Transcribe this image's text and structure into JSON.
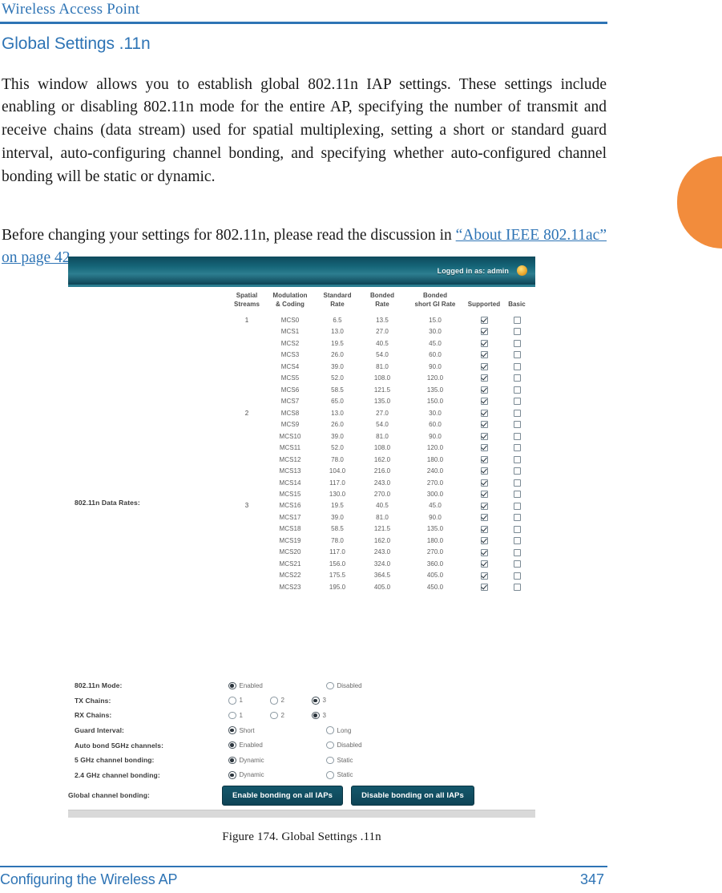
{
  "page": {
    "running_header": "Wireless Access Point",
    "section_heading": "Global Settings .11n",
    "footer_title": "Configuring the Wireless AP",
    "footer_page_number": "347",
    "accent_color": "#2e74b5",
    "tab_color": "#f28c3c"
  },
  "body": {
    "paragraph_1": "This window allows you to establish global 802.11n IAP settings. These settings include enabling or disabling 802.11n mode for the entire AP, specifying the number of transmit and receive chains (data stream) used for spatial multiplexing, setting a short or standard guard interval, auto-configuring channel bonding, and specifying whether auto-configured channel bonding will be static or dynamic.",
    "paragraph_2_lead": "Before changing your settings for 802.11n, please read the discussion in ",
    "paragraph_2_link": "“About IEEE 802.11ac” on page 42",
    "paragraph_2_tail": "."
  },
  "figure": {
    "caption": "Figure 174. Global Settings  .11n"
  },
  "screenshot": {
    "titlebar": {
      "logged_in_text": "Logged in as: admin",
      "logout_icon": "power-icon"
    },
    "rates_label": "802.11n Data Rates:",
    "table": {
      "headers": [
        "Spatial\nStreams",
        "Modulation\n& Coding",
        "Standard\nRate",
        "Bonded\nRate",
        "Bonded\nshort GI Rate",
        "Supported",
        "Basic"
      ],
      "headers_flat": {
        "spatial_streams": "Spatial Streams",
        "modulation_coding": "Modulation & Coding",
        "standard_rate": "Standard Rate",
        "bonded_rate": "Bonded Rate",
        "bonded_short_gi_rate": "Bonded short GI Rate",
        "supported": "Supported",
        "basic": "Basic"
      },
      "rows": [
        {
          "ss": "1",
          "mcs": "MCS0",
          "std": "6.5",
          "bonded": "13.5",
          "gi": "15.0",
          "supported": true,
          "basic": false
        },
        {
          "ss": "",
          "mcs": "MCS1",
          "std": "13.0",
          "bonded": "27.0",
          "gi": "30.0",
          "supported": true,
          "basic": false
        },
        {
          "ss": "",
          "mcs": "MCS2",
          "std": "19.5",
          "bonded": "40.5",
          "gi": "45.0",
          "supported": true,
          "basic": false
        },
        {
          "ss": "",
          "mcs": "MCS3",
          "std": "26.0",
          "bonded": "54.0",
          "gi": "60.0",
          "supported": true,
          "basic": false
        },
        {
          "ss": "",
          "mcs": "MCS4",
          "std": "39.0",
          "bonded": "81.0",
          "gi": "90.0",
          "supported": true,
          "basic": false
        },
        {
          "ss": "",
          "mcs": "MCS5",
          "std": "52.0",
          "bonded": "108.0",
          "gi": "120.0",
          "supported": true,
          "basic": false
        },
        {
          "ss": "",
          "mcs": "MCS6",
          "std": "58.5",
          "bonded": "121.5",
          "gi": "135.0",
          "supported": true,
          "basic": false
        },
        {
          "ss": "",
          "mcs": "MCS7",
          "std": "65.0",
          "bonded": "135.0",
          "gi": "150.0",
          "supported": true,
          "basic": false
        },
        {
          "ss": "2",
          "mcs": "MCS8",
          "std": "13.0",
          "bonded": "27.0",
          "gi": "30.0",
          "supported": true,
          "basic": false
        },
        {
          "ss": "",
          "mcs": "MCS9",
          "std": "26.0",
          "bonded": "54.0",
          "gi": "60.0",
          "supported": true,
          "basic": false
        },
        {
          "ss": "",
          "mcs": "MCS10",
          "std": "39.0",
          "bonded": "81.0",
          "gi": "90.0",
          "supported": true,
          "basic": false
        },
        {
          "ss": "",
          "mcs": "MCS11",
          "std": "52.0",
          "bonded": "108.0",
          "gi": "120.0",
          "supported": true,
          "basic": false
        },
        {
          "ss": "",
          "mcs": "MCS12",
          "std": "78.0",
          "bonded": "162.0",
          "gi": "180.0",
          "supported": true,
          "basic": false
        },
        {
          "ss": "",
          "mcs": "MCS13",
          "std": "104.0",
          "bonded": "216.0",
          "gi": "240.0",
          "supported": true,
          "basic": false
        },
        {
          "ss": "",
          "mcs": "MCS14",
          "std": "117.0",
          "bonded": "243.0",
          "gi": "270.0",
          "supported": true,
          "basic": false
        },
        {
          "ss": "",
          "mcs": "MCS15",
          "std": "130.0",
          "bonded": "270.0",
          "gi": "300.0",
          "supported": true,
          "basic": false
        },
        {
          "ss": "3",
          "mcs": "MCS16",
          "std": "19.5",
          "bonded": "40.5",
          "gi": "45.0",
          "supported": true,
          "basic": false
        },
        {
          "ss": "",
          "mcs": "MCS17",
          "std": "39.0",
          "bonded": "81.0",
          "gi": "90.0",
          "supported": true,
          "basic": false
        },
        {
          "ss": "",
          "mcs": "MCS18",
          "std": "58.5",
          "bonded": "121.5",
          "gi": "135.0",
          "supported": true,
          "basic": false
        },
        {
          "ss": "",
          "mcs": "MCS19",
          "std": "78.0",
          "bonded": "162.0",
          "gi": "180.0",
          "supported": true,
          "basic": false
        },
        {
          "ss": "",
          "mcs": "MCS20",
          "std": "117.0",
          "bonded": "243.0",
          "gi": "270.0",
          "supported": true,
          "basic": false
        },
        {
          "ss": "",
          "mcs": "MCS21",
          "std": "156.0",
          "bonded": "324.0",
          "gi": "360.0",
          "supported": true,
          "basic": false
        },
        {
          "ss": "",
          "mcs": "MCS22",
          "std": "175.5",
          "bonded": "364.5",
          "gi": "405.0",
          "supported": true,
          "basic": false
        },
        {
          "ss": "",
          "mcs": "MCS23",
          "std": "195.0",
          "bonded": "405.0",
          "gi": "450.0",
          "supported": true,
          "basic": false
        }
      ]
    },
    "settings": [
      {
        "label": "802.11n Mode:",
        "options": [
          {
            "text": "Enabled",
            "selected": true,
            "width": "w1"
          },
          {
            "text": "Disabled",
            "selected": false,
            "width": "w1"
          }
        ]
      },
      {
        "label": "TX Chains:",
        "options": [
          {
            "text": "1",
            "selected": false,
            "width": "wn"
          },
          {
            "text": "2",
            "selected": false,
            "width": "wn"
          },
          {
            "text": "3",
            "selected": true,
            "width": "wn"
          }
        ]
      },
      {
        "label": "RX Chains:",
        "options": [
          {
            "text": "1",
            "selected": false,
            "width": "wn"
          },
          {
            "text": "2",
            "selected": false,
            "width": "wn"
          },
          {
            "text": "3",
            "selected": true,
            "width": "wn"
          }
        ]
      },
      {
        "label": "Guard Interval:",
        "options": [
          {
            "text": "Short",
            "selected": true,
            "width": "w1"
          },
          {
            "text": "Long",
            "selected": false,
            "width": "w1"
          }
        ]
      },
      {
        "label": "Auto bond 5GHz channels:",
        "options": [
          {
            "text": "Enabled",
            "selected": true,
            "width": "w1"
          },
          {
            "text": "Disabled",
            "selected": false,
            "width": "w1"
          }
        ]
      },
      {
        "label": "5 GHz channel bonding:",
        "options": [
          {
            "text": "Dynamic",
            "selected": true,
            "width": "w1"
          },
          {
            "text": "Static",
            "selected": false,
            "width": "w1"
          }
        ]
      },
      {
        "label": "2.4 GHz channel bonding:",
        "options": [
          {
            "text": "Dynamic",
            "selected": true,
            "width": "w1"
          },
          {
            "text": "Static",
            "selected": false,
            "width": "w1"
          }
        ]
      }
    ],
    "global_bonding": {
      "label": "Global channel bonding:",
      "enable_button": "Enable bonding on all IAPs",
      "disable_button": "Disable bonding on all IAPs"
    }
  }
}
